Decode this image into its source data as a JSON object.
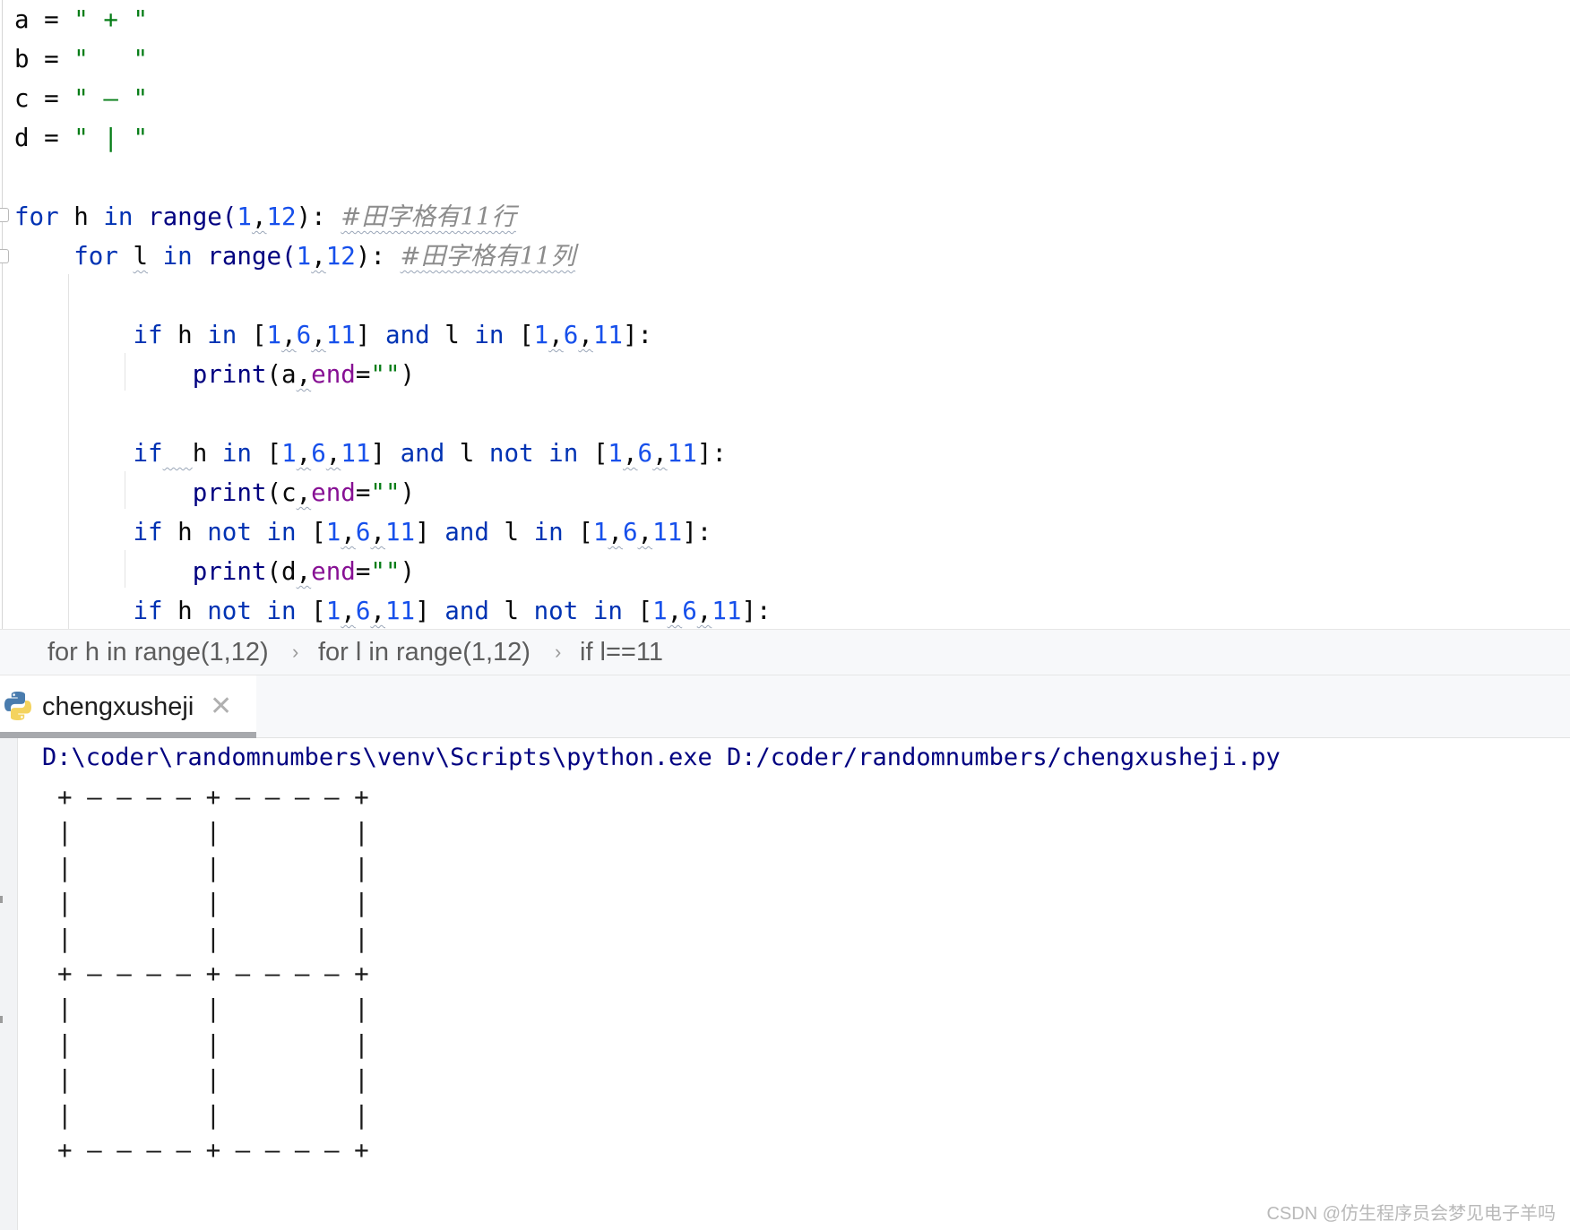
{
  "editor": {
    "code_lines": [
      {
        "segments": [
          {
            "t": "a = ",
            "c": ""
          },
          {
            "t": "\" + \"",
            "c": "str"
          }
        ]
      },
      {
        "segments": [
          {
            "t": "b = ",
            "c": ""
          },
          {
            "t": "\"   \"",
            "c": "str"
          }
        ]
      },
      {
        "segments": [
          {
            "t": "c = ",
            "c": ""
          },
          {
            "t": "\" — \"",
            "c": "str"
          }
        ]
      },
      {
        "segments": [
          {
            "t": "d = ",
            "c": ""
          },
          {
            "t": "\" | \"",
            "c": "str"
          }
        ]
      },
      {
        "segments": []
      },
      {
        "segments": [
          {
            "t": "for",
            "c": "kw"
          },
          {
            "t": " h ",
            "c": ""
          },
          {
            "t": "in",
            "c": "kw"
          },
          {
            "t": " range(",
            "c": "fn"
          },
          {
            "t": "1",
            "c": "num"
          },
          {
            "t": ",",
            "c": "wavy"
          },
          {
            "t": "12",
            "c": "num"
          },
          {
            "t": "): ",
            "c": ""
          },
          {
            "t": "#田字格有11行",
            "c": "cmt wavy"
          }
        ]
      },
      {
        "segments": [
          {
            "t": "    ",
            "c": ""
          },
          {
            "t": "for",
            "c": "kw"
          },
          {
            "t": " ",
            "c": ""
          },
          {
            "t": "l",
            "c": "wavy"
          },
          {
            "t": " ",
            "c": ""
          },
          {
            "t": "in",
            "c": "kw"
          },
          {
            "t": " range(",
            "c": "fn"
          },
          {
            "t": "1",
            "c": "num"
          },
          {
            "t": ",",
            "c": "wavy"
          },
          {
            "t": "12",
            "c": "num"
          },
          {
            "t": "): ",
            "c": ""
          },
          {
            "t": "#田字格有11列",
            "c": "cmt wavy"
          }
        ]
      },
      {
        "segments": []
      },
      {
        "segments": [
          {
            "t": "        ",
            "c": ""
          },
          {
            "t": "if",
            "c": "kw"
          },
          {
            "t": " h ",
            "c": ""
          },
          {
            "t": "in",
            "c": "kw"
          },
          {
            "t": " [",
            "c": ""
          },
          {
            "t": "1",
            "c": "num"
          },
          {
            "t": ",",
            "c": "wavy"
          },
          {
            "t": "6",
            "c": "num"
          },
          {
            "t": ",",
            "c": "wavy"
          },
          {
            "t": "11",
            "c": "num"
          },
          {
            "t": "] ",
            "c": ""
          },
          {
            "t": "and",
            "c": "kw"
          },
          {
            "t": " l ",
            "c": ""
          },
          {
            "t": "in",
            "c": "kw"
          },
          {
            "t": " [",
            "c": ""
          },
          {
            "t": "1",
            "c": "num"
          },
          {
            "t": ",",
            "c": "wavy"
          },
          {
            "t": "6",
            "c": "num"
          },
          {
            "t": ",",
            "c": "wavy"
          },
          {
            "t": "11",
            "c": "num"
          },
          {
            "t": "]:",
            "c": ""
          }
        ]
      },
      {
        "segments": [
          {
            "t": "            ",
            "c": ""
          },
          {
            "t": "print",
            "c": "fn"
          },
          {
            "t": "(a",
            "c": ""
          },
          {
            "t": ",",
            "c": "wavy"
          },
          {
            "t": "end",
            "c": "arg"
          },
          {
            "t": "=",
            "c": ""
          },
          {
            "t": "\"\"",
            "c": "str"
          },
          {
            "t": ")",
            "c": ""
          }
        ]
      },
      {
        "segments": []
      },
      {
        "segments": [
          {
            "t": "        ",
            "c": ""
          },
          {
            "t": "if",
            "c": "kw"
          },
          {
            "t": "  ",
            "c": "wavy"
          },
          {
            "t": "h ",
            "c": ""
          },
          {
            "t": "in",
            "c": "kw"
          },
          {
            "t": " [",
            "c": ""
          },
          {
            "t": "1",
            "c": "num"
          },
          {
            "t": ",",
            "c": "wavy"
          },
          {
            "t": "6",
            "c": "num"
          },
          {
            "t": ",",
            "c": "wavy"
          },
          {
            "t": "11",
            "c": "num"
          },
          {
            "t": "] ",
            "c": ""
          },
          {
            "t": "and",
            "c": "kw"
          },
          {
            "t": " l ",
            "c": ""
          },
          {
            "t": "not",
            "c": "kw"
          },
          {
            "t": " ",
            "c": ""
          },
          {
            "t": "in",
            "c": "kw"
          },
          {
            "t": " [",
            "c": ""
          },
          {
            "t": "1",
            "c": "num"
          },
          {
            "t": ",",
            "c": "wavy"
          },
          {
            "t": "6",
            "c": "num"
          },
          {
            "t": ",",
            "c": "wavy"
          },
          {
            "t": "11",
            "c": "num"
          },
          {
            "t": "]:",
            "c": ""
          }
        ]
      },
      {
        "segments": [
          {
            "t": "            ",
            "c": ""
          },
          {
            "t": "print",
            "c": "fn"
          },
          {
            "t": "(c",
            "c": ""
          },
          {
            "t": ",",
            "c": "wavy"
          },
          {
            "t": "end",
            "c": "arg"
          },
          {
            "t": "=",
            "c": ""
          },
          {
            "t": "\"\"",
            "c": "str"
          },
          {
            "t": ")",
            "c": ""
          }
        ]
      },
      {
        "segments": [
          {
            "t": "        ",
            "c": ""
          },
          {
            "t": "if",
            "c": "kw"
          },
          {
            "t": " h ",
            "c": ""
          },
          {
            "t": "not",
            "c": "kw"
          },
          {
            "t": " ",
            "c": ""
          },
          {
            "t": "in",
            "c": "kw"
          },
          {
            "t": " [",
            "c": ""
          },
          {
            "t": "1",
            "c": "num"
          },
          {
            "t": ",",
            "c": "wavy"
          },
          {
            "t": "6",
            "c": "num"
          },
          {
            "t": ",",
            "c": "wavy"
          },
          {
            "t": "11",
            "c": "num"
          },
          {
            "t": "] ",
            "c": ""
          },
          {
            "t": "and",
            "c": "kw"
          },
          {
            "t": " l ",
            "c": ""
          },
          {
            "t": "in",
            "c": "kw"
          },
          {
            "t": " [",
            "c": ""
          },
          {
            "t": "1",
            "c": "num"
          },
          {
            "t": ",",
            "c": "wavy"
          },
          {
            "t": "6",
            "c": "num"
          },
          {
            "t": ",",
            "c": "wavy"
          },
          {
            "t": "11",
            "c": "num"
          },
          {
            "t": "]:",
            "c": ""
          }
        ]
      },
      {
        "segments": [
          {
            "t": "            ",
            "c": ""
          },
          {
            "t": "print",
            "c": "fn"
          },
          {
            "t": "(d",
            "c": ""
          },
          {
            "t": ",",
            "c": "wavy"
          },
          {
            "t": "end",
            "c": "arg"
          },
          {
            "t": "=",
            "c": ""
          },
          {
            "t": "\"\"",
            "c": "str"
          },
          {
            "t": ")",
            "c": ""
          }
        ]
      },
      {
        "segments": [
          {
            "t": "        ",
            "c": ""
          },
          {
            "t": "if",
            "c": "kw"
          },
          {
            "t": " h ",
            "c": ""
          },
          {
            "t": "not",
            "c": "kw"
          },
          {
            "t": " ",
            "c": ""
          },
          {
            "t": "in",
            "c": "kw"
          },
          {
            "t": " [",
            "c": ""
          },
          {
            "t": "1",
            "c": "num"
          },
          {
            "t": ",",
            "c": "wavy"
          },
          {
            "t": "6",
            "c": "num"
          },
          {
            "t": ",",
            "c": "wavy"
          },
          {
            "t": "11",
            "c": "num"
          },
          {
            "t": "] ",
            "c": ""
          },
          {
            "t": "and",
            "c": "kw"
          },
          {
            "t": " l ",
            "c": ""
          },
          {
            "t": "not",
            "c": "kw"
          },
          {
            "t": " ",
            "c": ""
          },
          {
            "t": "in",
            "c": "kw"
          },
          {
            "t": " [",
            "c": ""
          },
          {
            "t": "1",
            "c": "num"
          },
          {
            "t": ",",
            "c": "wavy"
          },
          {
            "t": "6",
            "c": "num"
          },
          {
            "t": ",",
            "c": "wavy"
          },
          {
            "t": "11",
            "c": "num"
          },
          {
            "t": "]:",
            "c": ""
          }
        ]
      }
    ]
  },
  "breadcrumb": {
    "items": [
      "for h in range(1,12)",
      "for l in range(1,12)",
      "if l==11"
    ],
    "separator": "›"
  },
  "run_panel": {
    "tab_label": "chengxusheji",
    "close_glyph": "✕",
    "command": "D:\\coder\\randomnumbers\\venv\\Scripts\\python.exe D:/coder/randomnumbers/chengxusheji.py",
    "output_lines": [
      "+ — — — — + — — — — +",
      "|         |         |",
      "|         |         |",
      "|         |         |",
      "|         |         |",
      "+ — — — — + — — — — +",
      "|         |         |",
      "|         |         |",
      "|         |         |",
      "|         |         |",
      "+ — — — — + — — — — +"
    ]
  },
  "watermark": "CSDN @仿生程序员会梦见电子羊吗",
  "colors": {
    "keyword": "#0033b3",
    "number": "#1750eb",
    "string": "#067d17",
    "named_arg": "#871094",
    "builtin": "#000080",
    "comment": "#8c8c8c"
  }
}
